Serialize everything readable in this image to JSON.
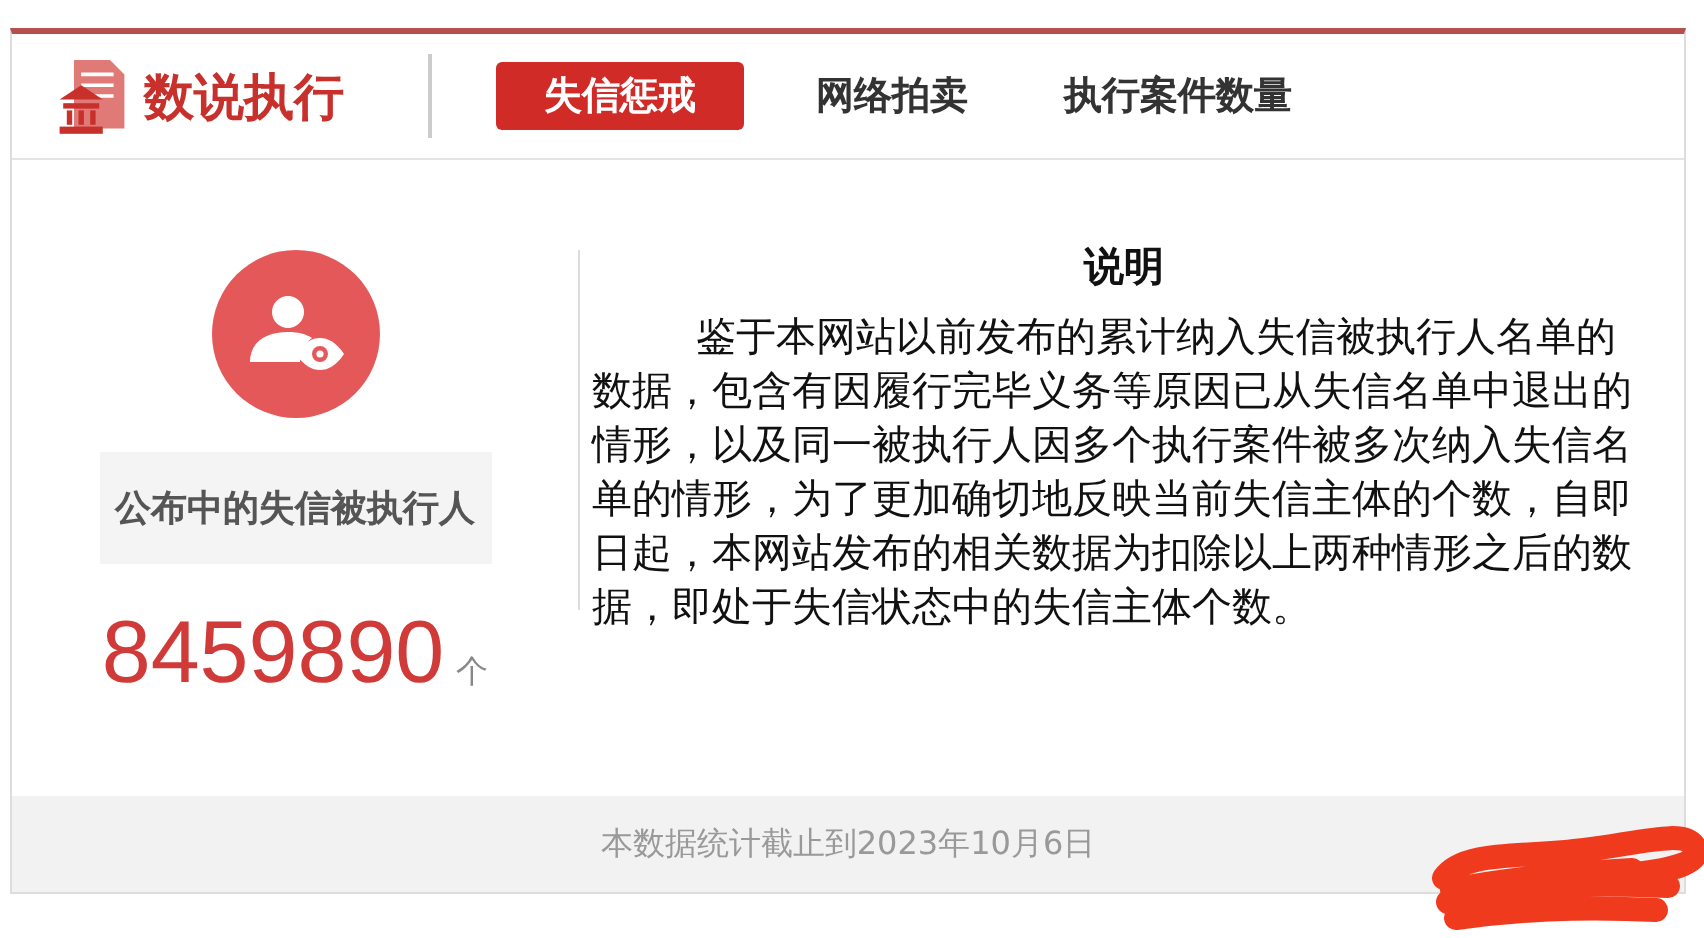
{
  "brand": {
    "title": "数说执行"
  },
  "tabs": [
    {
      "label": "失信惩戒",
      "selected": true
    },
    {
      "label": "网络拍卖",
      "selected": false
    },
    {
      "label": "执行案件数量",
      "selected": false
    }
  ],
  "stat": {
    "label": "公布中的失信被执行人",
    "value": "8459890",
    "unit": "个"
  },
  "note": {
    "title": "说明",
    "text": "鉴于本网站以前发布的累计纳入失信被执行人名单的数据，包含有因履行完毕义务等原因已从失信名单中退出的情形，以及同一被执行人因多个执行案件被多次纳入失信名单的情形，为了更加确切地反映当前失信主体的个数，自即日起，本网站发布的相关数据为扣除以上两种情形之后的数据，即处于失信状态中的失信主体个数。"
  },
  "footer": {
    "text": "本数据统计截止到2023年10月6日"
  }
}
